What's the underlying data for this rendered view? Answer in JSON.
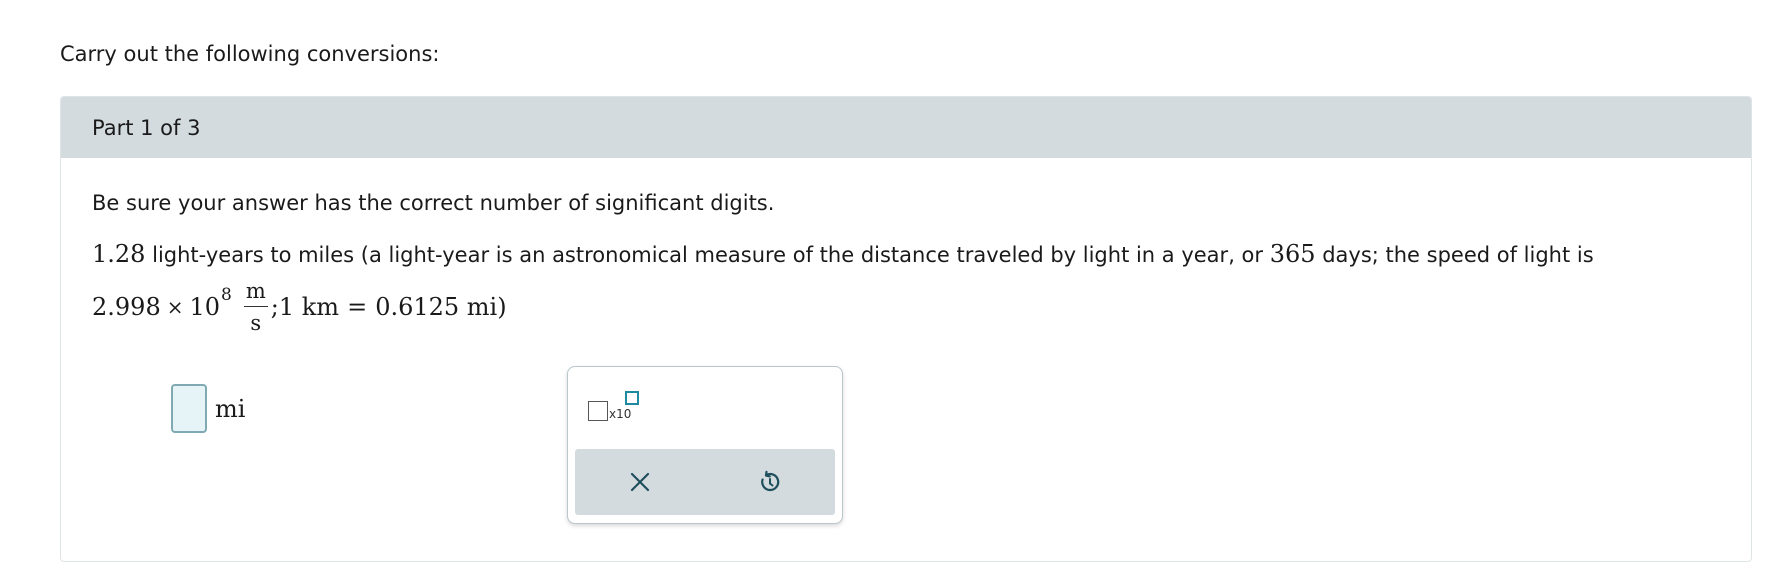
{
  "intro_text": "Carry out the following conversions:",
  "part": {
    "label": "Part 1 of 3"
  },
  "instruction": "Be sure your answer has the correct number of significant digits.",
  "problem": {
    "value": "1.28",
    "text_a": " light-years to miles (a light-year is an astronomical measure of the distance traveled by light in a year, or ",
    "days_value": "365",
    "text_b": " days; the speed of light is",
    "speed_mantissa": "2.998",
    "times_symbol": "×",
    "speed_base": "10",
    "speed_exponent": "8",
    "speed_unit_numerator": "m",
    "speed_unit_denominator": "s",
    "conversion_text": ";1 km",
    "equals_symbol": "=",
    "conversion_value": "0.6125 mi)"
  },
  "answer": {
    "unit": "mi"
  },
  "tools": {
    "sci_notation_label": "x10",
    "clear_icon": "close-icon",
    "undo_icon": "undo-icon",
    "accent_color": "#1e8aa0"
  }
}
